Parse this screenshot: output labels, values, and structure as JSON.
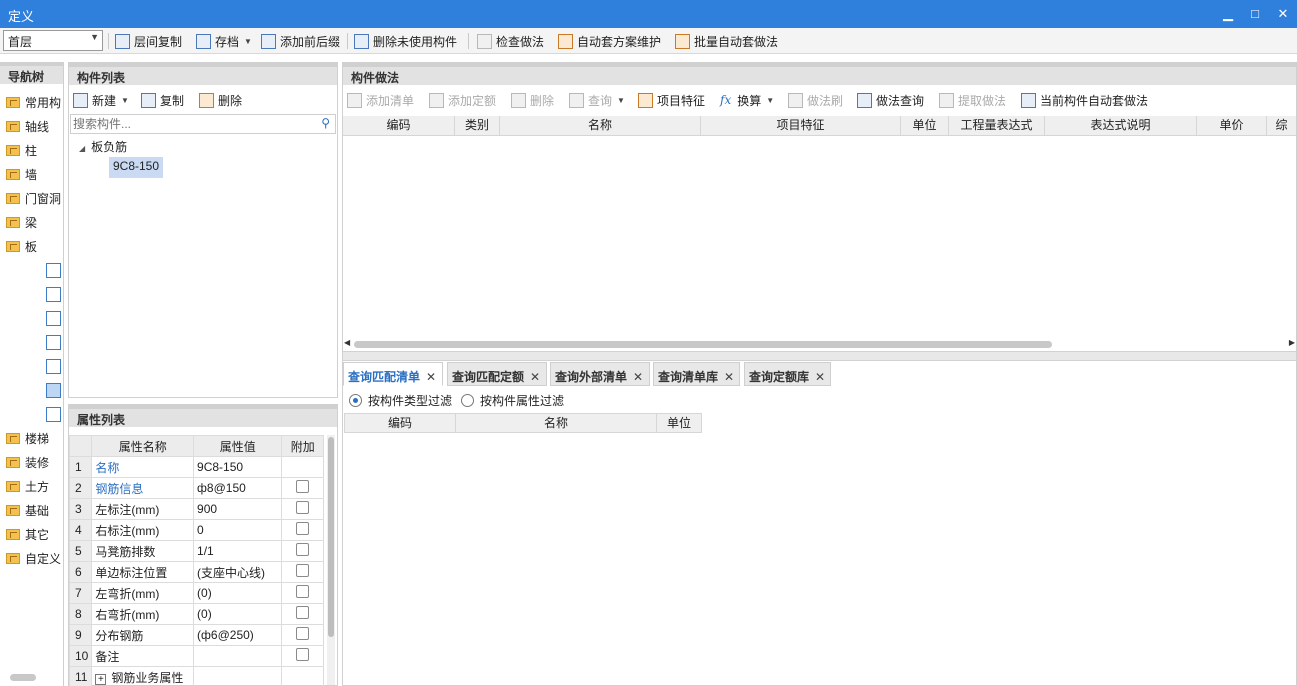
{
  "window": {
    "title": "定义"
  },
  "toolbar": {
    "floor": "首层",
    "items": [
      "层间复制",
      "存档",
      "添加前后缀",
      "删除未使用构件",
      "检查做法",
      "自动套方案维护",
      "批量自动套做法"
    ]
  },
  "nav": {
    "title": "导航树",
    "items": [
      "常用构",
      "轴线",
      "柱",
      "墙",
      "门窗洞",
      "梁",
      "板",
      "楼梯",
      "装修",
      "土方",
      "基础",
      "其它",
      "自定义"
    ]
  },
  "component_list": {
    "title": "构件列表",
    "actions": [
      "新建",
      "复制",
      "删除"
    ],
    "search_placeholder": "搜索构件...",
    "group": "板负筋",
    "item": "9C8-150"
  },
  "properties": {
    "title": "属性列表",
    "headers": [
      "属性名称",
      "属性值",
      "附加"
    ],
    "rows": [
      {
        "no": "1",
        "name": "名称",
        "value": "9C8-150"
      },
      {
        "no": "2",
        "name": "钢筋信息",
        "value": "ф8@150"
      },
      {
        "no": "3",
        "name": "左标注(mm)",
        "value": "900"
      },
      {
        "no": "4",
        "name": "右标注(mm)",
        "value": "0"
      },
      {
        "no": "5",
        "name": "马凳筋排数",
        "value": "1/1"
      },
      {
        "no": "6",
        "name": "单边标注位置",
        "value": "(支座中心线)"
      },
      {
        "no": "7",
        "name": "左弯折(mm)",
        "value": "(0)"
      },
      {
        "no": "8",
        "name": "右弯折(mm)",
        "value": "(0)"
      },
      {
        "no": "9",
        "name": "分布钢筋",
        "value": "(ф6@250)"
      },
      {
        "no": "10",
        "name": "备注",
        "value": ""
      },
      {
        "no": "11",
        "name": "钢筋业务属性",
        "value": ""
      }
    ]
  },
  "method": {
    "title": "构件做法",
    "actions": [
      "添加清单",
      "添加定额",
      "删除",
      "查询",
      "项目特征",
      "换算",
      "做法刷",
      "做法查询",
      "提取做法",
      "当前构件自动套做法"
    ],
    "columns": [
      "编码",
      "类别",
      "名称",
      "项目特征",
      "单位",
      "工程量表达式",
      "表达式说明",
      "单价",
      "综"
    ]
  },
  "query": {
    "tabs": [
      "查询匹配清单",
      "查询匹配定额",
      "查询外部清单",
      "查询清单库",
      "查询定额库"
    ],
    "filters": [
      "按构件类型过滤",
      "按构件属性过滤"
    ],
    "columns": [
      "编码",
      "名称",
      "单位"
    ]
  }
}
